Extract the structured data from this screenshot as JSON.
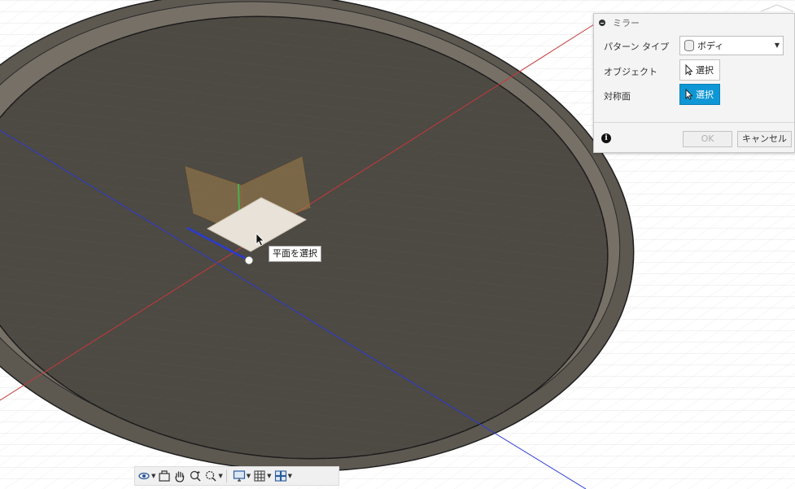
{
  "dialog": {
    "title": "ミラー",
    "pattern_type_label": "パターン タイプ",
    "pattern_type_value": "ボディ",
    "object_label": "オブジェクト",
    "object_button": "選択",
    "plane_label": "対称面",
    "plane_button": "選択",
    "ok_label": "OK",
    "cancel_label": "キャンセル"
  },
  "tooltip": {
    "text": "平面を選択"
  },
  "navbar": {
    "icons": [
      "orbit-icon",
      "look-at-icon",
      "pan-icon",
      "zoom-icon",
      "fit-icon",
      "display-settings-icon",
      "grid-icon",
      "viewports-icon"
    ]
  },
  "colors": {
    "accent": "#0f97d5",
    "body_dark": "#4d4943",
    "rim": "#5d5951",
    "x_axis": "#c23a3a",
    "z_axis": "#2a3bd1"
  }
}
